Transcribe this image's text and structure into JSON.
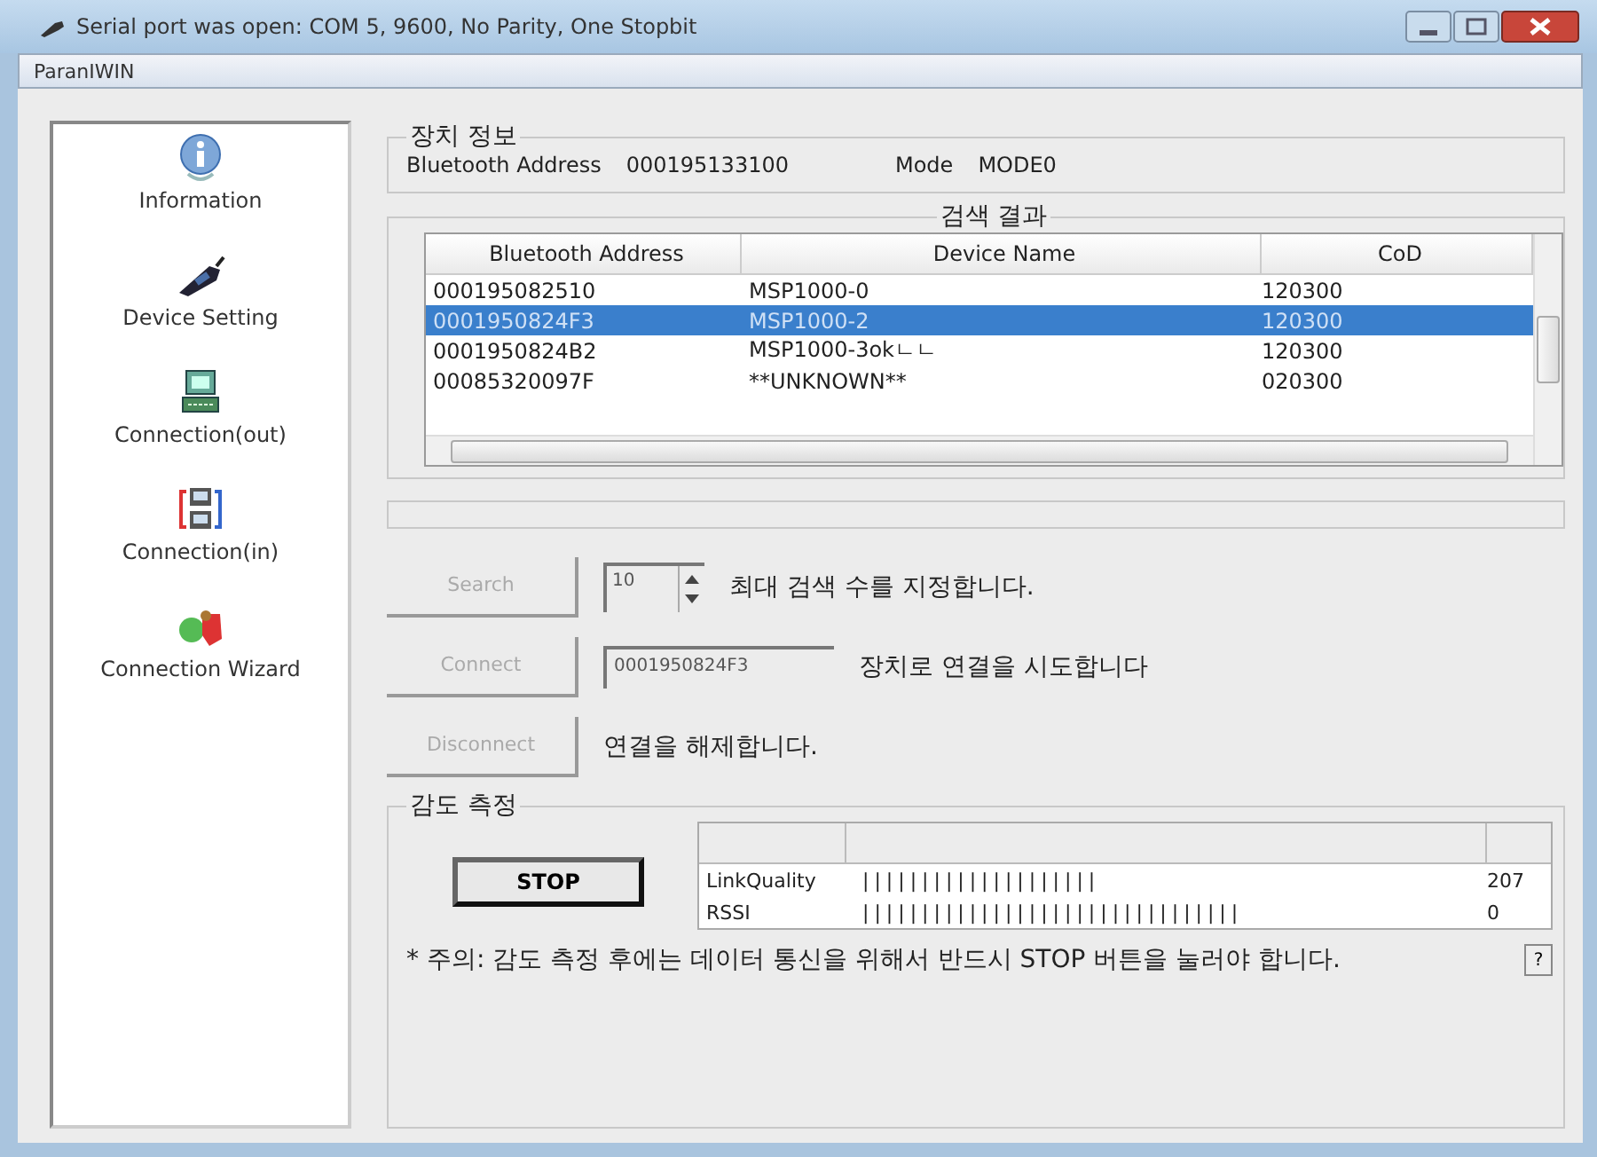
{
  "window": {
    "title": "Serial port was open: COM 5, 9600, No Parity, One Stopbit"
  },
  "tab": {
    "label": "ParanIWIN"
  },
  "sidebar": {
    "items": [
      {
        "label": "Information",
        "kind": "info"
      },
      {
        "label": "Device Setting",
        "kind": "device"
      },
      {
        "label": "Connection(out)",
        "kind": "out"
      },
      {
        "label": "Connection(in)",
        "kind": "in"
      },
      {
        "label": "Connection Wizard",
        "kind": "wizard"
      }
    ]
  },
  "device_info": {
    "title": "장치 정보",
    "address_label": "Bluetooth Address",
    "address": "000195133100",
    "mode_label": "Mode",
    "mode": "MODE0"
  },
  "search_results": {
    "title": "검색 결과",
    "columns": [
      "Bluetooth Address",
      "Device Name",
      "CoD"
    ],
    "rows": [
      {
        "cells": [
          "000195082510",
          "MSP1000-0",
          "120300"
        ],
        "selected": false
      },
      {
        "cells": [
          "0001950824F3",
          "MSP1000-2",
          "120300"
        ],
        "selected": true
      },
      {
        "cells": [
          "0001950824B2",
          "MSP1000-3okㄴㄴ",
          "120300"
        ],
        "selected": false
      },
      {
        "cells": [
          "00085320097F",
          "**UNKNOWN**",
          "020300"
        ],
        "selected": false
      }
    ]
  },
  "controls": [
    {
      "kind": "spin",
      "label": "Search",
      "disabled": true,
      "field": "10",
      "description": "최대 검색 수를 지정합니다."
    },
    {
      "kind": "text",
      "label": "Connect",
      "disabled": true,
      "field": "0001950824F3",
      "description": "장치로 연결을 시도합니다"
    },
    {
      "kind": "plain",
      "label": "Disconnect",
      "disabled": true,
      "description": "연결을 해제합니다."
    }
  ],
  "sensitivity": {
    "title": "감도 측정",
    "stop_button": "STOP",
    "meters": [
      {
        "name": "LinkQuality",
        "bar": "||||||||||||||||||||",
        "reading": "207"
      },
      {
        "name": "RSSI",
        "bar": "||||||||||||||||||||||||||||||||",
        "reading": "0"
      }
    ],
    "note": "* 주의: 감도 측정 후에는 데이터 통신을 위해서 반드시 STOP 버튼을 눌러야 합니다.",
    "help_button": "?"
  }
}
